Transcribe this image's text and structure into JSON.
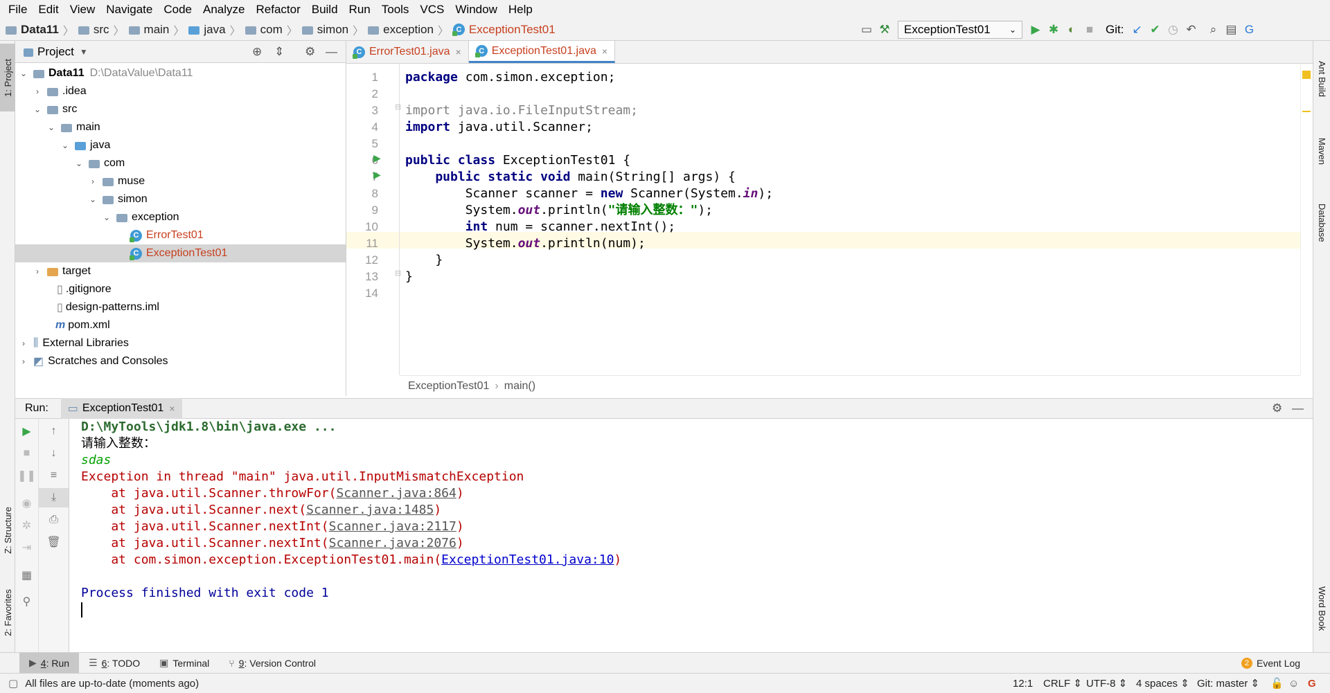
{
  "menu": [
    "File",
    "Edit",
    "View",
    "Navigate",
    "Code",
    "Analyze",
    "Refactor",
    "Build",
    "Run",
    "Tools",
    "VCS",
    "Window",
    "Help"
  ],
  "breadcrumb": [
    "Data11",
    "src",
    "main",
    "java",
    "com",
    "simon",
    "exception",
    "ExceptionTest01"
  ],
  "toolbar": {
    "run_config": "ExceptionTest01",
    "git_label": "Git:"
  },
  "left_stripe": {
    "project": "1: Project",
    "structure": "Z: Structure",
    "favorites": "2: Favorites"
  },
  "right_stripe": {
    "ant": "Ant Build",
    "maven": "Maven",
    "database": "Database",
    "wordbook": "Word Book"
  },
  "project_panel": {
    "title": "Project",
    "tree": [
      {
        "label": "Data11",
        "path": "D:\\DataValue\\Data11"
      },
      {
        "label": ".idea"
      },
      {
        "label": "src"
      },
      {
        "label": "main"
      },
      {
        "label": "java"
      },
      {
        "label": "com"
      },
      {
        "label": "muse"
      },
      {
        "label": "simon"
      },
      {
        "label": "exception"
      },
      {
        "label": "ErrorTest01"
      },
      {
        "label": "ExceptionTest01"
      },
      {
        "label": "target"
      },
      {
        "label": ".gitignore"
      },
      {
        "label": "design-patterns.iml"
      },
      {
        "label": "pom.xml"
      },
      {
        "label": "External Libraries"
      },
      {
        "label": "Scratches and Consoles"
      }
    ]
  },
  "editor": {
    "tabs": [
      "ErrorTest01.java",
      "ExceptionTest01.java"
    ],
    "line_numbers": [
      "1",
      "2",
      "3",
      "4",
      "5",
      "6",
      "7",
      "8",
      "9",
      "10",
      "11",
      "12",
      "13",
      "14"
    ],
    "code": {
      "l1_kw": "package",
      "l1_rest": " com.simon.exception;",
      "l3_kw": "import",
      "l3_rest": " java.io.FileInputStream;",
      "l4_kw": "import",
      "l4_rest": " java.util.Scanner;",
      "l6_kw": "public class",
      "l6_rest": " ExceptionTest01 {",
      "l7_kw": "    public static void",
      "l7_rest": " main(String[] args) {",
      "l8_a": "        Scanner scanner = ",
      "l8_kw": "new",
      "l8_b": " Scanner(System.",
      "l8_f": "in",
      "l8_c": ");",
      "l9_a": "        System.",
      "l9_f": "out",
      "l9_b": ".println(",
      "l9_s": "\"请输入整数：\"",
      "l9_c": ");",
      "l10_kw": "        int",
      "l10_rest": " num = scanner.nextInt();",
      "l11_a": "        System.",
      "l11_f": "out",
      "l11_b": ".println(num);",
      "l12": "    }",
      "l13": "}"
    },
    "breadcrumb": [
      "ExceptionTest01",
      "main()"
    ]
  },
  "run_panel": {
    "label": "Run:",
    "tab": "ExceptionTest01",
    "console": {
      "cmd": "D:\\MyTools\\jdk1.8\\bin\\java.exe ...",
      "prompt": "请输入整数：",
      "input": "sdas",
      "exception": "Exception in thread \"main\" java.util.InputMismatchException",
      "traces": [
        {
          "prefix": "    at java.util.Scanner.throwFor(",
          "link": "Scanner.java:864",
          "suffix": ")"
        },
        {
          "prefix": "    at java.util.Scanner.next(",
          "link": "Scanner.java:1485",
          "suffix": ")"
        },
        {
          "prefix": "    at java.util.Scanner.nextInt(",
          "link": "Scanner.java:2117",
          "suffix": ")"
        },
        {
          "prefix": "    at java.util.Scanner.nextInt(",
          "link": "Scanner.java:2076",
          "suffix": ")"
        },
        {
          "prefix": "    at com.simon.exception.ExceptionTest01.main(",
          "link": "ExceptionTest01.java:10",
          "suffix": ")"
        }
      ],
      "finished": "Process finished with exit code 1"
    }
  },
  "bottom_tabs": {
    "run_num": "4",
    "run": ": Run",
    "todo_num": "6",
    "todo": ": TODO",
    "terminal": "Terminal",
    "vc_num": "9",
    "vc": ": Version Control",
    "event_count": "2",
    "event_log": "Event Log"
  },
  "status": {
    "message": "All files are up-to-date (moments ago)",
    "position": "12:1",
    "line_sep": "CRLF",
    "encoding": "UTF-8",
    "indent": "4 spaces",
    "git": "Git: master"
  }
}
